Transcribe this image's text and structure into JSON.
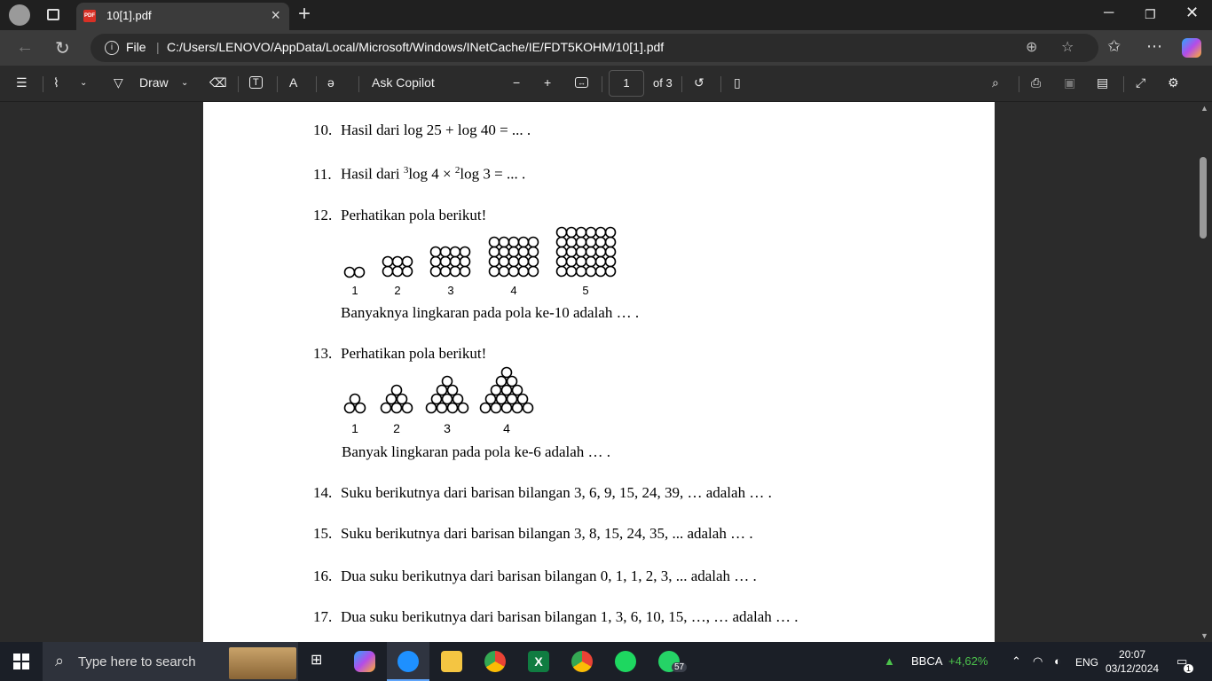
{
  "browser": {
    "tab_title": "10[1].pdf",
    "address_scheme": "File",
    "address_url": "C:/Users/LENOVO/AppData/Local/Microsoft/Windows/INetCache/IE/FDT5KOHM/10[1].pdf"
  },
  "toolbar": {
    "draw_label": "Draw",
    "ask_copilot_label": "Ask Copilot",
    "page_number": "1",
    "page_total": "of 3"
  },
  "document": {
    "q10": {
      "num": "10.",
      "text": "Hasil dari log 25 + log 40 = ... ."
    },
    "q11": {
      "num": "11.",
      "prefix": "Hasil dari ",
      "sup1": "3",
      "mid": "log 4 × ",
      "sup2": "2",
      "suffix": "log 3 = ... ."
    },
    "q12": {
      "num": "12.",
      "text": "Perhatikan pola berikut!",
      "labels": [
        "1",
        "2",
        "3",
        "4",
        "5"
      ],
      "question": "Banyaknya lingkaran pada pola ke-10 adalah … ."
    },
    "q13": {
      "num": "13.",
      "text": "Perhatikan pola berikut!",
      "labels": [
        "1",
        "2",
        "3",
        "4"
      ],
      "question": "Banyak lingkaran pada pola ke-6 adalah … ."
    },
    "q14": {
      "num": "14.",
      "text": "Suku berikutnya dari barisan bilangan 3, 6, 9, 15, 24, 39, … adalah … ."
    },
    "q15": {
      "num": "15.",
      "text": "Suku berikutnya dari barisan bilangan 3, 8, 15, 24, 35, ... adalah … ."
    },
    "q16": {
      "num": "16.",
      "text": "Dua suku berikutnya dari barisan bilangan 0, 1, 1, 2, 3, ... adalah … ."
    },
    "q17": {
      "num": "17.",
      "text": "Dua suku berikutnya dari barisan bilangan 1, 3, 6, 10, 15, …, … adalah … ."
    }
  },
  "taskbar": {
    "search_placeholder": "Type here to search",
    "whatsapp_badge": "57",
    "stock_name": "BBCA",
    "stock_change": "+4,62%",
    "language": "ENG",
    "time": "20:07",
    "date": "03/12/2024",
    "notification_count": "1"
  },
  "colors": {
    "stock_up": "#4cc24c",
    "pdf_red": "#d93025",
    "edge_blue": "#1e90ff",
    "excel_green": "#107c41",
    "spotify_green": "#1ed760",
    "whatsapp_green": "#25d366"
  }
}
